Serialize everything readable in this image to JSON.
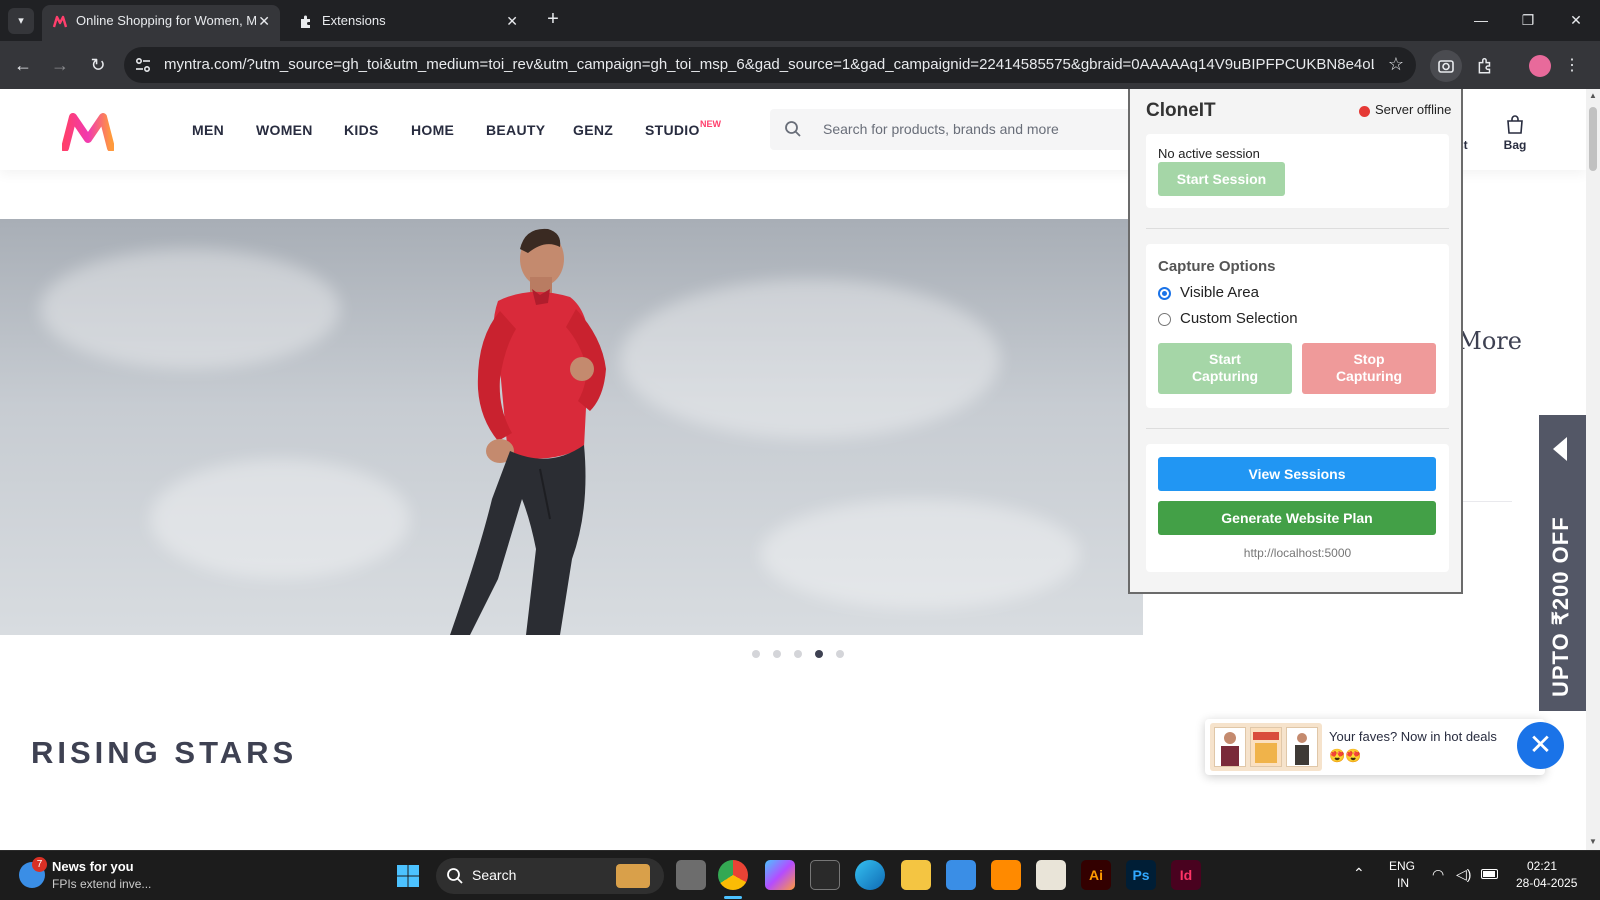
{
  "browser": {
    "tabs": [
      {
        "title": "Online Shopping for Women, M",
        "active": true
      },
      {
        "title": "Extensions",
        "active": false
      }
    ],
    "url": "myntra.com/?utm_source=gh_toi&utm_medium=toi_rev&utm_campaign=gh_toi_msp_6&gad_source=1&gad_campaignid=22414585575&gbraid=0AAAAAq14V9uBIPFPCUKBN8e4oL4og...",
    "icons": {
      "back": "back-arrow-icon",
      "forward": "forward-arrow-icon",
      "reload": "reload-icon",
      "bookmark": "star-icon",
      "extension": "capture-extension-icon",
      "extensions_menu": "puzzle-icon",
      "profile": "profile-avatar-icon",
      "menu": "kebab-menu-icon"
    }
  },
  "site": {
    "nav": [
      "MEN",
      "WOMEN",
      "KIDS",
      "HOME",
      "BEAUTY",
      "GENZ",
      "STUDIO"
    ],
    "studio_badge": "NEW",
    "search_placeholder": "Search for products, brands and more",
    "header_right": {
      "wishlist_partial": "st",
      "bag": "Bag"
    },
    "carousel": {
      "count": 5,
      "active_index": 3
    },
    "section_title": "RISING STARS",
    "side_partial_text": "t More",
    "offer_tab": "UPTO ₹200 OFF",
    "toast": {
      "message": "Your faves? Now in hot deals 😍😍"
    },
    "colors": {
      "brand_pink": "#ff3f6c",
      "text_dark": "#282c3f",
      "toast_close": "#1a73e8"
    }
  },
  "popup": {
    "title": "CloneIT",
    "server_status": "Server offline",
    "session_status": "No active session",
    "start_session": "Start Session",
    "capture_heading": "Capture Options",
    "options": [
      {
        "label": "Visible Area",
        "checked": true
      },
      {
        "label": "Custom Selection",
        "checked": false
      }
    ],
    "start_capturing": "Start Capturing",
    "stop_capturing": "Stop Capturing",
    "view_sessions": "View Sessions",
    "generate_plan": "Generate Website Plan",
    "server_url": "http://localhost:5000",
    "colors": {
      "green": "#43a047",
      "green_disabled": "#a5d6a7",
      "red_disabled": "#ef9a9a",
      "blue": "#2196f3",
      "status_red": "#e53935"
    }
  },
  "taskbar": {
    "news_title": "News for you",
    "news_sub": "FPIs extend inve...",
    "news_badge": "7",
    "search_label": "Search",
    "language": "ENG",
    "region": "IN",
    "time": "02:21",
    "date": "28-04-2025"
  }
}
